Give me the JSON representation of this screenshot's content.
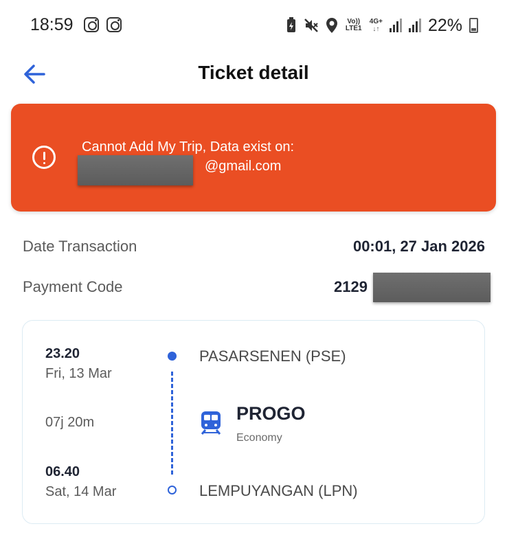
{
  "status_bar": {
    "time": "18:59",
    "network_volte": "Vo)) LTE1",
    "network_4g": "4G+",
    "battery_percent": "22%"
  },
  "header": {
    "title": "Ticket detail"
  },
  "toast": {
    "message": "Cannot Add My Trip, Data exist on:",
    "email_suffix": "@gmail.com",
    "accent_color": "#ea4e23"
  },
  "details": {
    "date_transaction_label": "Date Transaction",
    "date_transaction_value": "00:01, 27 Jan 2026",
    "payment_code_label": "Payment Code",
    "payment_code_visible": "2129"
  },
  "trip": {
    "departure_time": "23.20",
    "departure_date": "Fri, 13 Mar",
    "duration": "07j 20m",
    "arrival_time": "06.40",
    "arrival_date": "Sat, 14 Mar",
    "origin_station": "PASARSENEN (PSE)",
    "destination_station": "LEMPUYANGAN (LPN)",
    "train_name": "PROGO",
    "train_class": "Economy",
    "line_color": "#2f63d9"
  }
}
